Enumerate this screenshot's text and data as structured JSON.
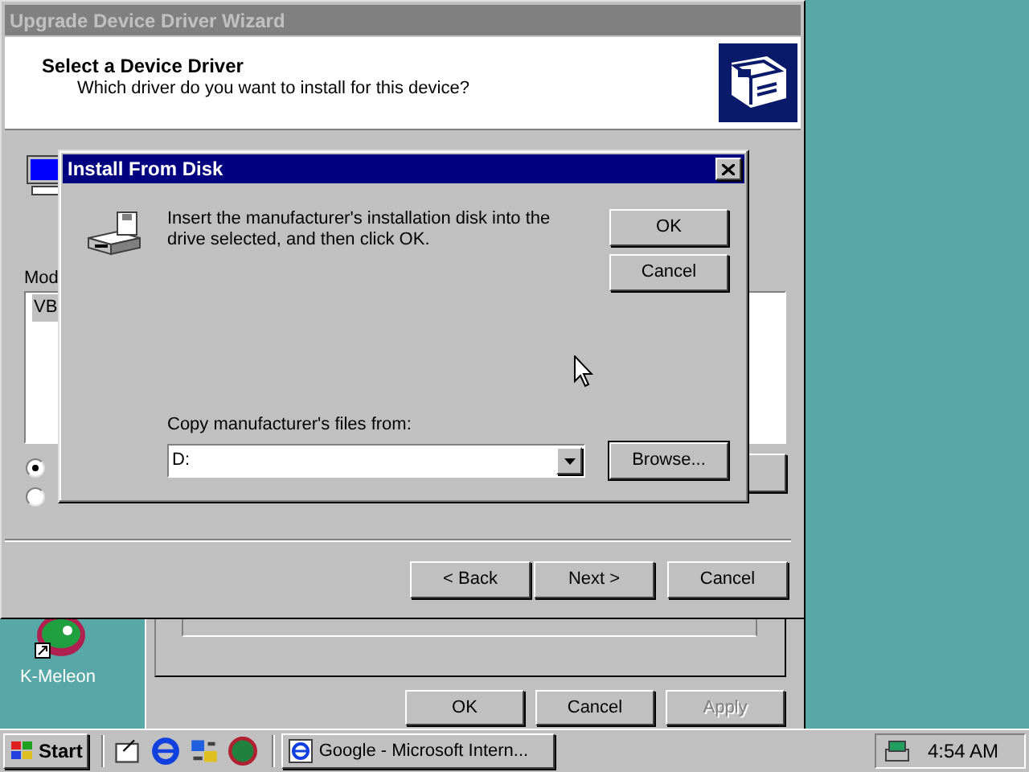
{
  "desktop": {
    "icons": [
      {
        "label": "K-Meleon"
      }
    ]
  },
  "back_window": {
    "buttons": [
      {
        "label": "OK",
        "disabled": false
      },
      {
        "label": "Cancel",
        "disabled": false
      },
      {
        "label": "Apply",
        "disabled": true
      }
    ]
  },
  "wizard": {
    "title": "Upgrade Device Driver Wizard",
    "active": false,
    "heading": "Select a Device Driver",
    "subheading": "Which driver do you want to install for this device?",
    "models_label": "Mod",
    "models": [
      {
        "label": "VB"
      }
    ],
    "options": [
      {
        "selected": true
      },
      {
        "selected": false
      }
    ],
    "buttons": [
      {
        "label": "< Back"
      },
      {
        "label": "Next >"
      },
      {
        "label": "Cancel"
      }
    ]
  },
  "dialog": {
    "title": "Install From Disk",
    "active": true,
    "message": "Insert the manufacturer's installation disk into the drive selected, and then click OK.",
    "buttons": [
      {
        "label": "OK"
      },
      {
        "label": "Cancel"
      }
    ],
    "copy_label": "Copy manufacturer's files from:",
    "path": "D:",
    "browse": "Browse..."
  },
  "taskbar": {
    "start": "Start",
    "tasks": [
      {
        "label": "Google - Microsoft Intern...",
        "selected": false
      }
    ],
    "clock": "4:54 AM"
  }
}
